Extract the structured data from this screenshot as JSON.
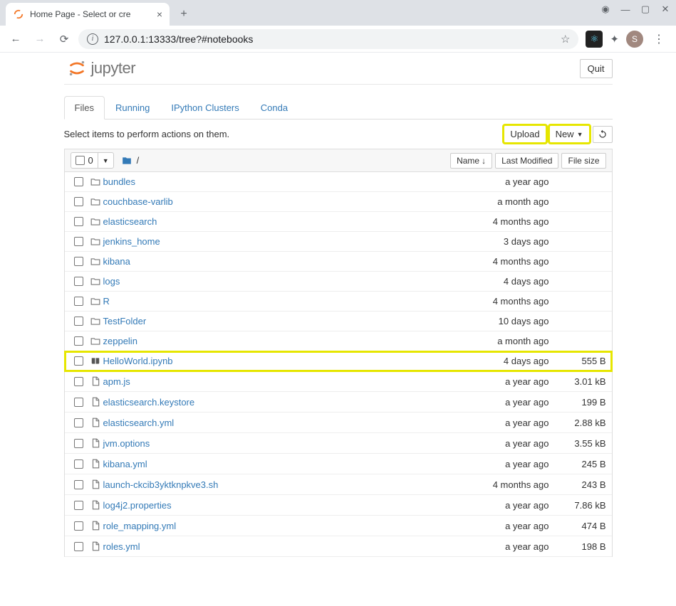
{
  "browser": {
    "tab_title": "Home Page - Select or cre",
    "url": "127.0.0.1:13333/tree?#notebooks",
    "avatar_letter": "S"
  },
  "header": {
    "brand": "jupyter",
    "quit": "Quit"
  },
  "tabs": [
    {
      "label": "Files",
      "active": true
    },
    {
      "label": "Running",
      "active": false
    },
    {
      "label": "IPython Clusters",
      "active": false
    },
    {
      "label": "Conda",
      "active": false
    }
  ],
  "toolbar": {
    "instructions": "Select items to perform actions on them.",
    "upload": "Upload",
    "new": "New",
    "selected_count": "0"
  },
  "columns": {
    "name": "Name",
    "modified": "Last Modified",
    "size": "File size",
    "breadcrumb_sep": "/"
  },
  "items": [
    {
      "type": "folder",
      "name": "bundles",
      "modified": "a year ago",
      "size": ""
    },
    {
      "type": "folder",
      "name": "couchbase-varlib",
      "modified": "a month ago",
      "size": ""
    },
    {
      "type": "folder",
      "name": "elasticsearch",
      "modified": "4 months ago",
      "size": ""
    },
    {
      "type": "folder",
      "name": "jenkins_home",
      "modified": "3 days ago",
      "size": ""
    },
    {
      "type": "folder",
      "name": "kibana",
      "modified": "4 months ago",
      "size": ""
    },
    {
      "type": "folder",
      "name": "logs",
      "modified": "4 days ago",
      "size": ""
    },
    {
      "type": "folder",
      "name": "R",
      "modified": "4 months ago",
      "size": ""
    },
    {
      "type": "folder",
      "name": "TestFolder",
      "modified": "10 days ago",
      "size": ""
    },
    {
      "type": "folder",
      "name": "zeppelin",
      "modified": "a month ago",
      "size": ""
    },
    {
      "type": "notebook",
      "name": "HelloWorld.ipynb",
      "modified": "4 days ago",
      "size": "555 B",
      "highlighted": true
    },
    {
      "type": "file",
      "name": "apm.js",
      "modified": "a year ago",
      "size": "3.01 kB"
    },
    {
      "type": "file",
      "name": "elasticsearch.keystore",
      "modified": "a year ago",
      "size": "199 B"
    },
    {
      "type": "file",
      "name": "elasticsearch.yml",
      "modified": "a year ago",
      "size": "2.88 kB"
    },
    {
      "type": "file",
      "name": "jvm.options",
      "modified": "a year ago",
      "size": "3.55 kB"
    },
    {
      "type": "file",
      "name": "kibana.yml",
      "modified": "a year ago",
      "size": "245 B"
    },
    {
      "type": "file",
      "name": "launch-ckcib3yktknpkve3.sh",
      "modified": "4 months ago",
      "size": "243 B"
    },
    {
      "type": "file",
      "name": "log4j2.properties",
      "modified": "a year ago",
      "size": "7.86 kB"
    },
    {
      "type": "file",
      "name": "role_mapping.yml",
      "modified": "a year ago",
      "size": "474 B"
    },
    {
      "type": "file",
      "name": "roles.yml",
      "modified": "a year ago",
      "size": "198 B"
    }
  ]
}
